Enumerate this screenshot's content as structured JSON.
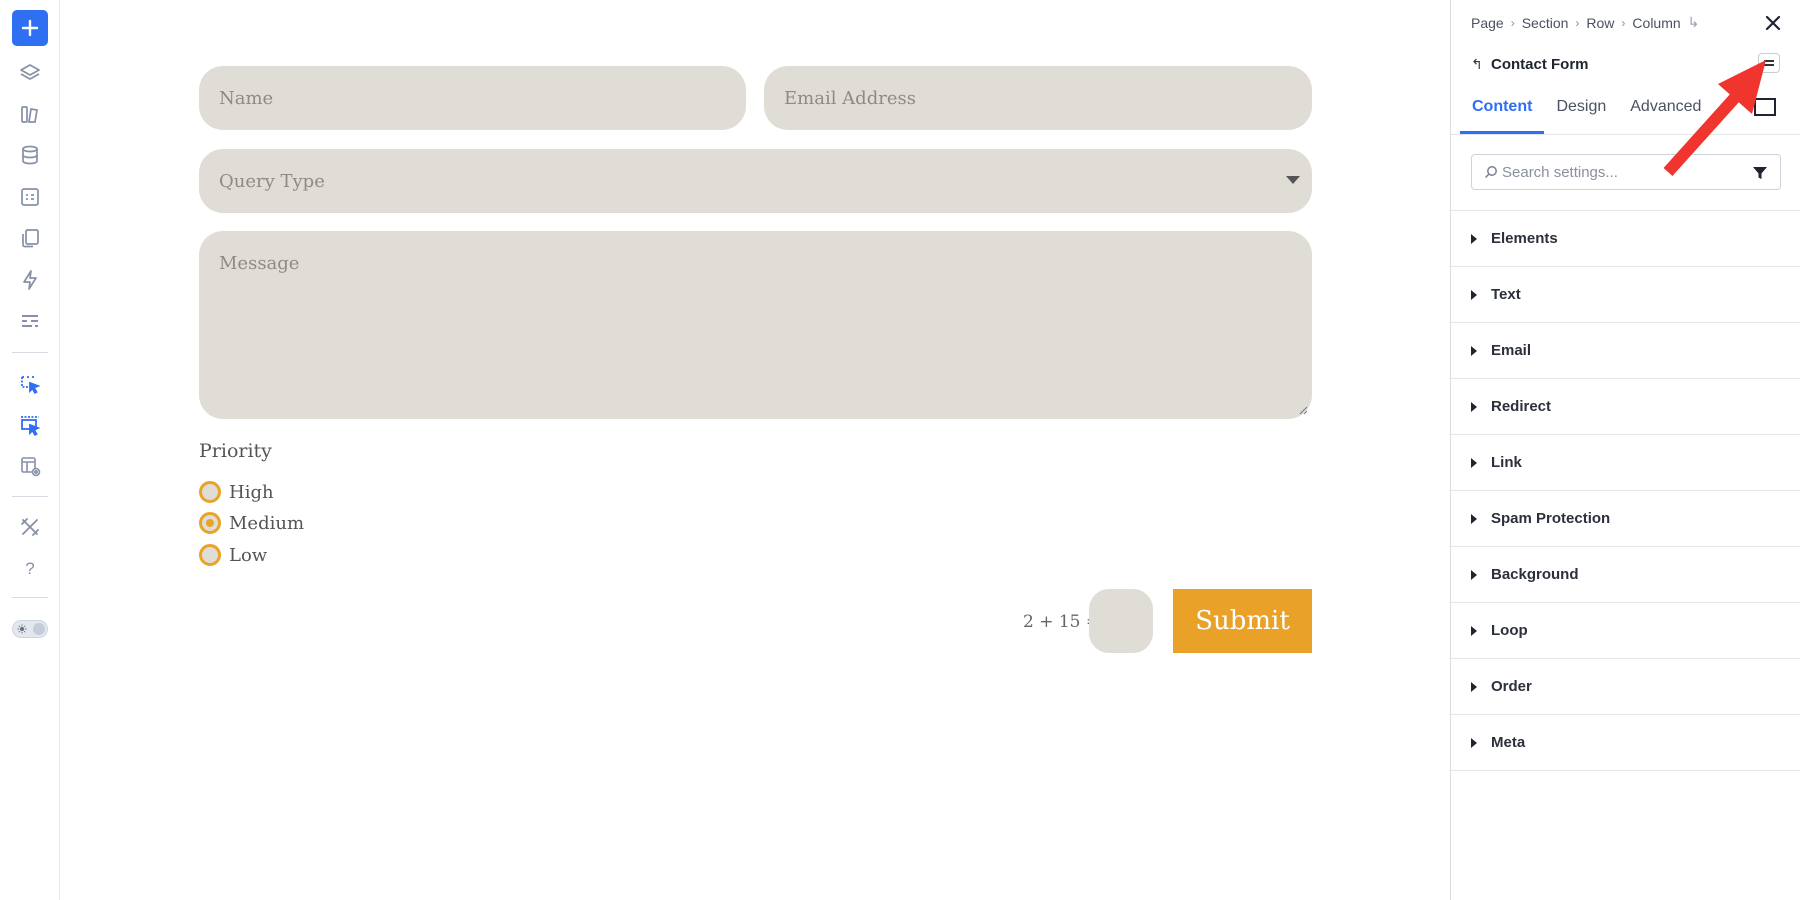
{
  "left_toolbar": {
    "icons": [
      "add-icon",
      "layers-icon",
      "library-icon",
      "database-icon",
      "form-icon",
      "pages-icon",
      "lightning-icon",
      "sliders-icon",
      "select-icon",
      "multi-select-icon",
      "preview-icon",
      "tools-icon",
      "help-icon",
      "theme-toggle"
    ],
    "help_label": "?",
    "accent": "#2f6ff2"
  },
  "form": {
    "name_placeholder": "Name",
    "email_placeholder": "Email Address",
    "query_placeholder": "Query Type",
    "message_placeholder": "Message",
    "priority_label": "Priority",
    "priority_options": [
      {
        "label": "High",
        "checked": false
      },
      {
        "label": "Medium",
        "checked": true
      },
      {
        "label": "Low",
        "checked": false
      }
    ],
    "captcha": "2 + 15 =",
    "submit_label": "Submit",
    "field_color": "#e0ddd6",
    "button_color": "#e9a227"
  },
  "panel": {
    "breadcrumb": [
      "Page",
      "Section",
      "Row",
      "Column"
    ],
    "breadcrumb_end_icon": "↳",
    "title": "Contact Form",
    "tabs": [
      {
        "label": "Content",
        "active": true
      },
      {
        "label": "Design",
        "active": false
      },
      {
        "label": "Advanced",
        "active": false
      }
    ],
    "search_placeholder": "Search settings...",
    "groups": [
      "Elements",
      "Text",
      "Email",
      "Redirect",
      "Link",
      "Spam Protection",
      "Background",
      "Loop",
      "Order",
      "Meta"
    ]
  },
  "annotation_color": "#f0342e"
}
